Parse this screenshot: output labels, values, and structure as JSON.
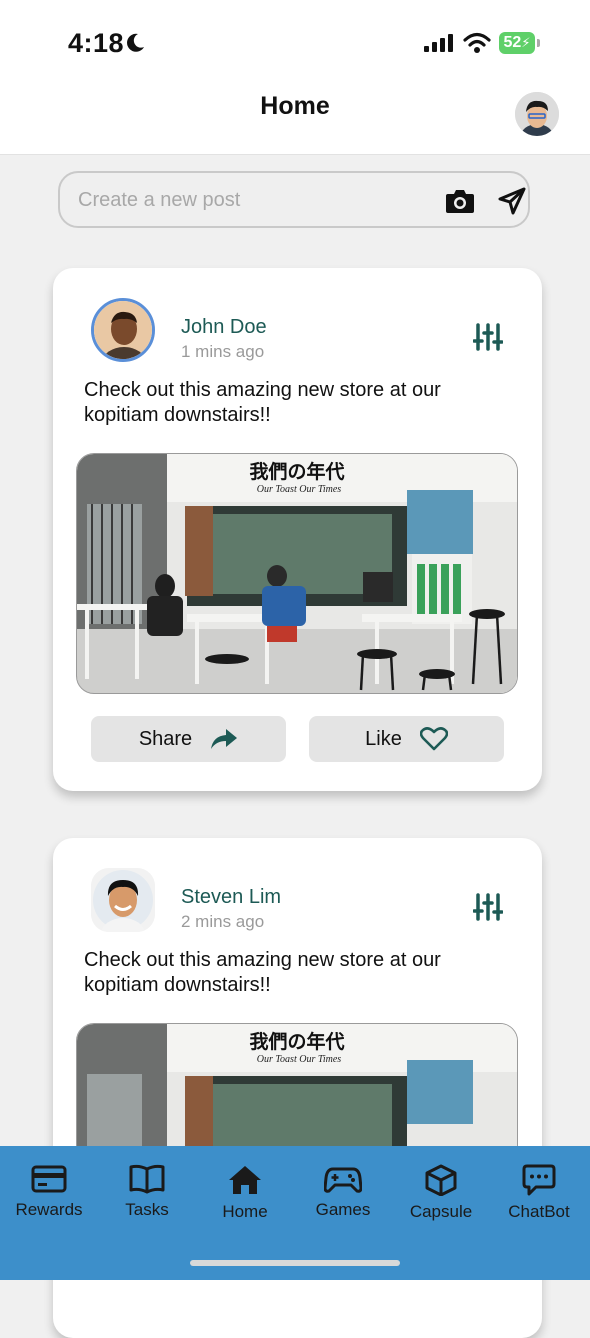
{
  "status_bar": {
    "time": "4:18",
    "battery": "52"
  },
  "header": {
    "title": "Home"
  },
  "composer": {
    "placeholder": "Create a new post"
  },
  "posts": [
    {
      "author": "John Doe",
      "time": "1 mins ago",
      "text": "Check out this amazing new store at our kopitiam downstairs!!",
      "image": {
        "sign_main": "我們の年代",
        "sign_sub": "Our Toast Our Times"
      }
    },
    {
      "author": "Steven Lim",
      "time": "2 mins ago",
      "text": "Check out this amazing new store at our kopitiam downstairs!!",
      "image": {
        "sign_main": "我們の年代",
        "sign_sub": "Our Toast Our Times"
      }
    }
  ],
  "actions": {
    "share": "Share",
    "like": "Like"
  },
  "tabs": [
    {
      "label": "Rewards",
      "icon": "card-icon"
    },
    {
      "label": "Tasks",
      "icon": "book-icon"
    },
    {
      "label": "Home",
      "icon": "home-icon"
    },
    {
      "label": "Games",
      "icon": "gamepad-icon"
    },
    {
      "label": "Capsule",
      "icon": "cube-icon"
    },
    {
      "label": "ChatBot",
      "icon": "chat-icon"
    }
  ],
  "colors": {
    "accent": "#3d8fca",
    "author": "#1d5a55",
    "battery": "#5fd069"
  }
}
